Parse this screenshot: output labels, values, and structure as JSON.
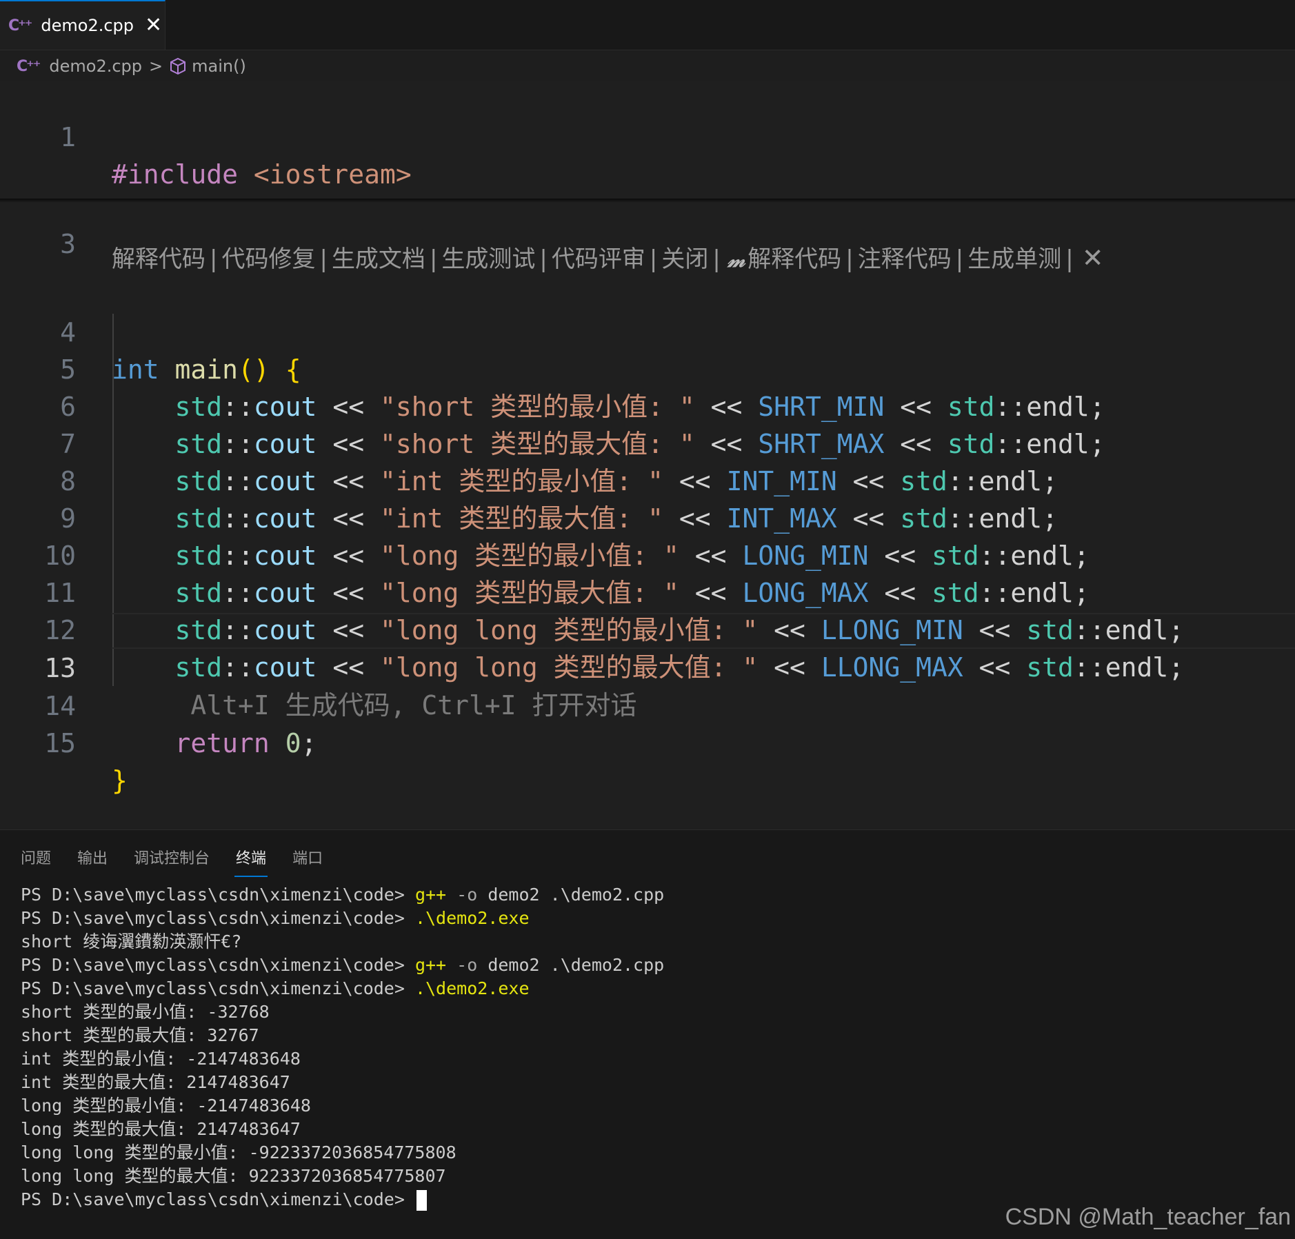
{
  "tab": {
    "label": "demo2.cpp",
    "close": "✕"
  },
  "breadcrumb": {
    "file": "demo2.cpp",
    "symbol": "main()",
    "separator": ">"
  },
  "editor": {
    "line_numbers": [
      "1",
      "3",
      "4",
      "5",
      "6",
      "7",
      "8",
      "9",
      "10",
      "11",
      "12",
      "13",
      "14",
      "15"
    ],
    "codelens": [
      "解释代码",
      "代码修复",
      "生成文档",
      "生成测试",
      "代码评审",
      "关闭",
      "解释代码",
      "注释代码",
      "生成单测"
    ],
    "codelens_sep": "|",
    "codelens_close": "✕",
    "ghost_hint": "Alt+I 生成代码, Ctrl+I 打开对话",
    "include": {
      "directive": "#include",
      "header": "<iostream>"
    },
    "main_sig": {
      "type": "int",
      "name": "main",
      "parens": "()",
      "brace": "{"
    },
    "std": "std",
    "cout": "cout",
    "endl": "endl",
    "op": "<<",
    "scope": "::",
    "semi": ";",
    "statements": [
      {
        "str": "\"short 类型的最小值: \"",
        "macro": "SHRT_MIN"
      },
      {
        "str": "\"short 类型的最大值: \"",
        "macro": "SHRT_MAX"
      },
      {
        "str": "\"int 类型的最小值: \"",
        "macro": "INT_MIN"
      },
      {
        "str": "\"int 类型的最大值: \"",
        "macro": "INT_MAX"
      },
      {
        "str": "\"long 类型的最小值: \"",
        "macro": "LONG_MIN"
      },
      {
        "str": "\"long 类型的最大值: \"",
        "macro": "LONG_MAX"
      },
      {
        "str": "\"long long 类型的最小值: \"",
        "macro": "LLONG_MIN"
      },
      {
        "str": "\"long long 类型的最大值: \"",
        "macro": "LLONG_MAX"
      }
    ],
    "return_kw": "return",
    "return_val": "0",
    "close_brace": "}"
  },
  "panel": {
    "tabs": [
      "问题",
      "输出",
      "调试控制台",
      "终端",
      "端口"
    ],
    "active_tab": "终端"
  },
  "terminal": {
    "prompt": "PS D:\\save\\myclass\\csdn\\ximenzi\\code> ",
    "compile": {
      "cmd": "g++",
      "flag": "-o",
      "rest": " demo2 .\\demo2.cpp"
    },
    "run": ".\\demo2.exe",
    "garbled": "short 绫诲瀷鐨勬渶灏忓€?",
    "output": [
      "short 类型的最小值: -32768",
      "short 类型的最大值: 32767",
      "int 类型的最小值: -2147483648",
      "int 类型的最大值: 2147483647",
      "long 类型的最小值: -2147483648",
      "long 类型的最大值: 2147483647",
      "long long 类型的最小值: -9223372036854775808",
      "long long 类型的最大值: 9223372036854775807"
    ]
  },
  "watermark": "CSDN @Math_teacher_fan",
  "colors": {
    "accent": "#0078d4",
    "keyword": "#569cd6",
    "string": "#ce9178",
    "namespace": "#4ec9b0",
    "terminal_cmd": "#e5e510"
  }
}
